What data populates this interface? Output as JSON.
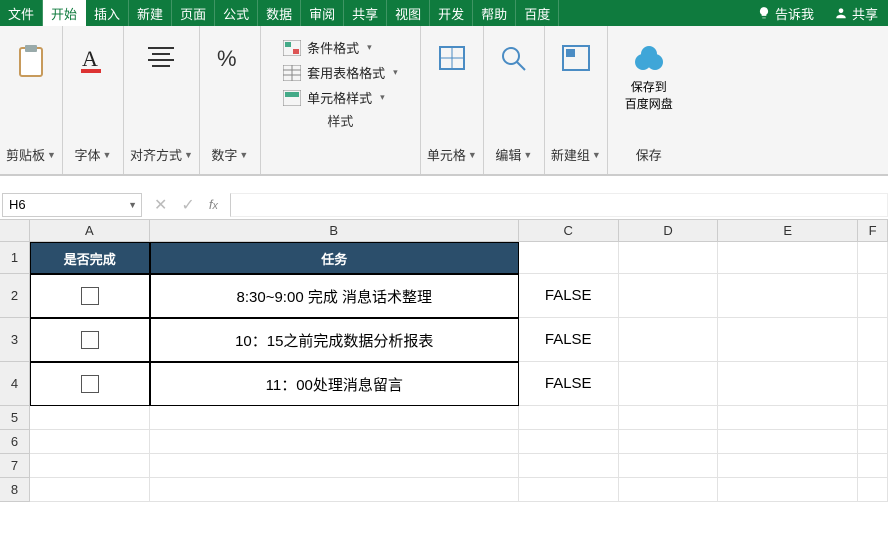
{
  "menu": {
    "tabs": [
      "文件",
      "开始",
      "插入",
      "新建",
      "页面",
      "公式",
      "数据",
      "审阅",
      "共享",
      "视图",
      "开发",
      "帮助",
      "百度"
    ],
    "active_index": 1,
    "tell_me": "告诉我",
    "share": "共享"
  },
  "ribbon": {
    "clipboard": {
      "label": "剪贴板"
    },
    "font": {
      "label": "字体"
    },
    "align": {
      "label": "对齐方式"
    },
    "number": {
      "label": "数字"
    },
    "styles": {
      "label": "样式",
      "cond_format": "条件格式",
      "table_format": "套用表格格式",
      "cell_styles": "单元格样式"
    },
    "cells": {
      "label": "单元格"
    },
    "editing": {
      "label": "编辑"
    },
    "newgroup": {
      "label": "新建组"
    },
    "save": {
      "label": "保存",
      "btn": "保存到\n百度网盘"
    }
  },
  "namebox": "H6",
  "sheet": {
    "col_headers": [
      "A",
      "B",
      "C",
      "D",
      "E",
      "F"
    ],
    "row_headers": [
      "1",
      "2",
      "3",
      "4",
      "5",
      "6",
      "7",
      "8"
    ],
    "header_row": {
      "a": "是否完成",
      "b": "任务"
    },
    "rows": [
      {
        "task": "8:30~9:00 完成 消息话术整理",
        "c": "FALSE"
      },
      {
        "task": "10：15之前完成数据分析报表",
        "c": "FALSE"
      },
      {
        "task": "11：00处理消息留言",
        "c": "FALSE"
      }
    ]
  }
}
